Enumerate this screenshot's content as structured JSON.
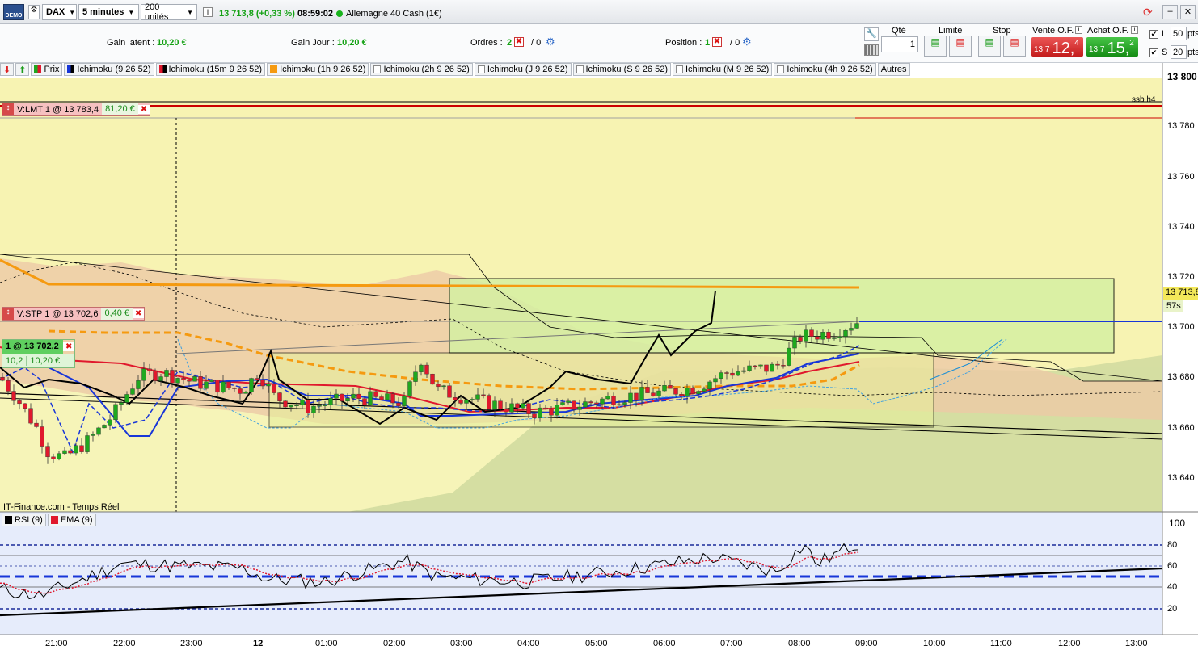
{
  "toolbar": {
    "badge": "DEMO",
    "instrument": "DAX",
    "timeframe": "5 minutes",
    "units": "200 unités",
    "price_change": "13 713,8 (+0,33 %)",
    "clock": "08:59:02",
    "market": "Allemagne 40 Cash (1€)"
  },
  "status": {
    "gain_latent_label": "Gain latent :",
    "gain_latent_value": "10,20 €",
    "gain_jour_label": "Gain Jour :",
    "gain_jour_value": "10,20 €",
    "orders_label": "Ordres :",
    "orders_count": "2",
    "orders_sep": "/ 0",
    "position_label": "Position :",
    "position_count": "1",
    "position_sep": "/ 0"
  },
  "order_panel": {
    "qty_label": "Qté",
    "qty_value": "1",
    "limit_label": "Limite",
    "stop_label": "Stop",
    "sell_label": "Vente O.F.",
    "sell_small": "13 7",
    "sell_big": "12,",
    "sell_sup": "4",
    "buy_label": "Achat O.F.",
    "buy_small": "13 7",
    "buy_big": "15,",
    "buy_sup": "2",
    "l_label": "L",
    "l_value": "50",
    "s_label": "S",
    "s_value": "20",
    "pts": "pts",
    "pts2": "pts"
  },
  "legend": [
    "Prix",
    "Ichimoku (9 26 52)",
    "Ichimoku (15m 9 26 52)",
    "Ichimoku (1h 9 26 52)",
    "Ichimoku (2h 9 26 52)",
    "Ichimoku (J 9 26 52)",
    "Ichimoku (S 9 26 52)",
    "Ichimoku (M 9 26 52)",
    "Ichimoku (4h 9 26 52)",
    "Autres"
  ],
  "orders": {
    "lmt_label": "V:LMT  1 @ 13 783,4",
    "lmt_gain": "81,20 €",
    "stp_label": "V:STP  1 @ 13 702,6",
    "stp_gain": "0,40 €",
    "pos_label": "1 @ 13 702,2",
    "pos_pts": "10,2",
    "pos_gain": "10,20 €"
  },
  "chart": {
    "ssb_label": "ssb h4",
    "source_label": "IT-Finance.com - Temps Réel",
    "last_price": "13 713,8",
    "countdown": "57s",
    "price_ticks": [
      "13 800",
      "13 780",
      "13 760",
      "13 740",
      "13 720",
      "13 700",
      "13 680",
      "13 660",
      "13 640"
    ],
    "time_ticks": [
      "21:00",
      "22:00",
      "23:00",
      "12",
      "01:00",
      "02:00",
      "03:00",
      "04:00",
      "05:00",
      "06:00",
      "07:00",
      "08:00",
      "09:00",
      "10:00",
      "11:00",
      "12:00",
      "13:00"
    ]
  },
  "rsi": {
    "legend": [
      "RSI (9)",
      "EMA (9)"
    ],
    "ticks": [
      "100",
      "80",
      "60",
      "40",
      "20"
    ]
  },
  "colors": {
    "bull": "#1fa81f",
    "bear": "#e0182d",
    "tenkan": "#1836d8",
    "kijun": "#e0182d",
    "orange": "#f59a10",
    "chikou": "#000000"
  }
}
